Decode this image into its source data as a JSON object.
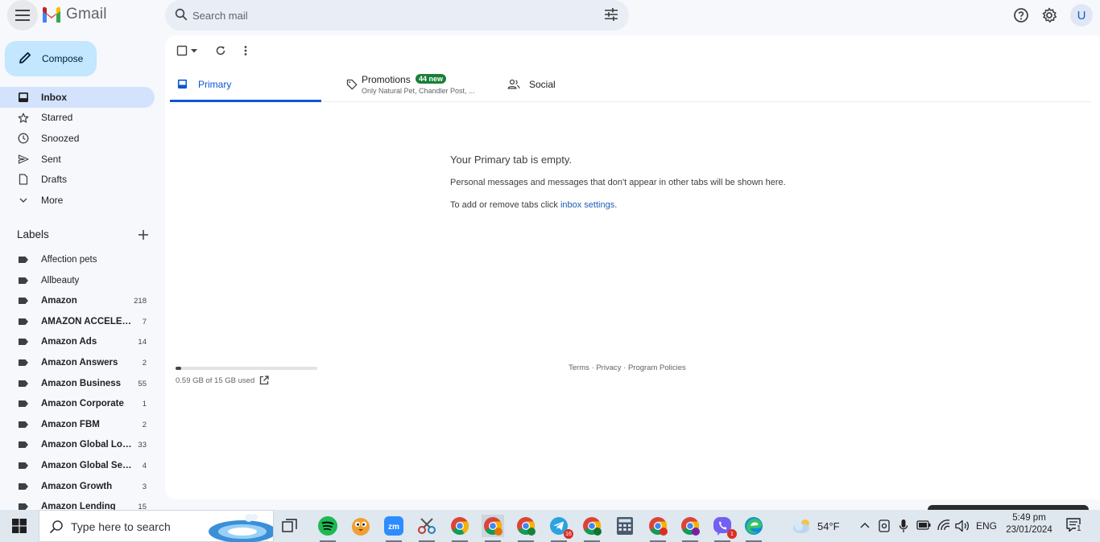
{
  "app": {
    "logo_text": "Gmail",
    "avatar_initial": "U"
  },
  "search": {
    "placeholder": "Search mail"
  },
  "compose_label": "Compose",
  "nav": [
    {
      "label": "Inbox",
      "icon": "inbox-icon",
      "active": true
    },
    {
      "label": "Starred",
      "icon": "star-icon"
    },
    {
      "label": "Snoozed",
      "icon": "clock-icon"
    },
    {
      "label": "Sent",
      "icon": "send-icon"
    },
    {
      "label": "Drafts",
      "icon": "draft-icon"
    },
    {
      "label": "More",
      "icon": "chevron-down-icon"
    }
  ],
  "labels_heading": "Labels",
  "labels": [
    {
      "name": "Affection pets",
      "count": "",
      "bold": false
    },
    {
      "name": "Allbeauty",
      "count": "",
      "bold": false
    },
    {
      "name": "Amazon",
      "count": "218",
      "bold": true
    },
    {
      "name": "AMAZON ACCELERATOR",
      "count": "7",
      "bold": true
    },
    {
      "name": "Amazon Ads",
      "count": "14",
      "bold": true
    },
    {
      "name": "Amazon Answers",
      "count": "2",
      "bold": true
    },
    {
      "name": "Amazon Business",
      "count": "55",
      "bold": true
    },
    {
      "name": "Amazon Corporate",
      "count": "1",
      "bold": true
    },
    {
      "name": "Amazon FBM",
      "count": "2",
      "bold": true
    },
    {
      "name": "Amazon Global Logistics",
      "count": "33",
      "bold": true
    },
    {
      "name": "Amazon Global Selling",
      "count": "4",
      "bold": true
    },
    {
      "name": "Amazon Growth",
      "count": "3",
      "bold": true
    },
    {
      "name": "Amazon Lending",
      "count": "15",
      "bold": true
    }
  ],
  "tabs": {
    "primary": "Primary",
    "promotions": "Promotions",
    "promotions_badge": "44 new",
    "promotions_sub": "Only Natural Pet, Chandler Post, ...",
    "social": "Social"
  },
  "empty_state": {
    "title": "Your Primary tab is empty.",
    "line1": "Personal messages and messages that don't appear in other tabs will be shown here.",
    "line2_prefix": "To add or remove tabs click ",
    "line2_link": "inbox settings",
    "line2_suffix": "."
  },
  "storage": {
    "text": "0.59 GB of 15 GB used",
    "fraction": 0.039
  },
  "footer": {
    "terms": "Terms",
    "privacy": "Privacy",
    "policies": "Program Policies",
    "sep": " · "
  },
  "taskbar": {
    "search_text": "Type here to search",
    "weather": "54°F",
    "language": "ENG",
    "time": "5:49 pm",
    "date": "23/01/2024",
    "notif_count": "1",
    "telegram_badge": "16",
    "viber_badge": "1"
  },
  "colors": {
    "accent": "#0b57d0",
    "compose_bg": "#c2e7ff",
    "active_nav": "#d3e3fd",
    "badge_green": "#188038"
  }
}
